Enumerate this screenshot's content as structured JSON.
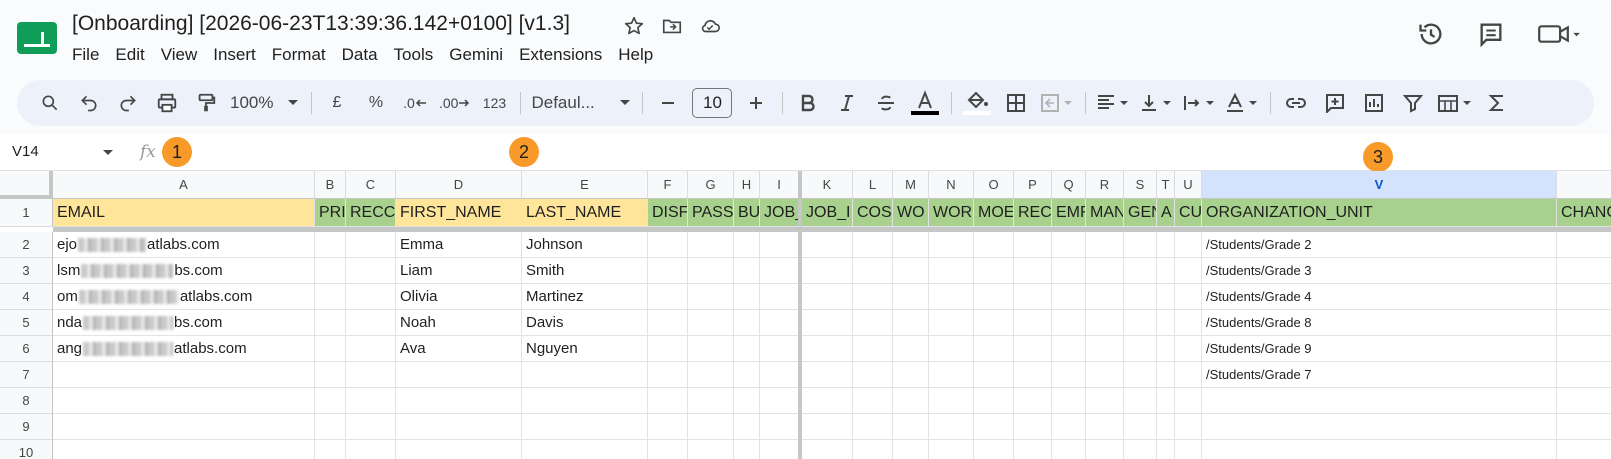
{
  "window": {
    "title": "[Onboarding] [2026-06-23T13:39:36.142+0100] [v1.3]"
  },
  "menu": [
    "File",
    "Edit",
    "View",
    "Insert",
    "Format",
    "Data",
    "Tools",
    "Gemini",
    "Extensions",
    "Help"
  ],
  "toolbar": {
    "zoom": "100%",
    "currency": "£",
    "percent": "%",
    "decrease_decimal": ".0",
    "increase_decimal": ".00",
    "number_format": "123",
    "font": "Defaul...",
    "font_size": "10"
  },
  "formula_bar": {
    "cell_ref": "V14",
    "fx": "fx",
    "content": ""
  },
  "markers": [
    "1",
    "2",
    "3"
  ],
  "columns": [
    "A",
    "B",
    "C",
    "D",
    "E",
    "F",
    "G",
    "H",
    "I",
    "K",
    "L",
    "M",
    "N",
    "O",
    "P",
    "Q",
    "R",
    "S",
    "T",
    "U",
    "V"
  ],
  "selected_column": "V",
  "row_numbers": [
    "1",
    "2",
    "3",
    "4",
    "5",
    "6",
    "7",
    "8",
    "9",
    "10"
  ],
  "header_row": {
    "A": "EMAIL",
    "B": "PRI",
    "C": "RECC",
    "D": "FIRST_NAME",
    "E": "LAST_NAME",
    "F": "DISF",
    "G": "PASS",
    "H": "BU",
    "I": "JOB_",
    "K": "JOB_I",
    "L": "COS",
    "M": "WO",
    "N": "WOR",
    "O": "MOE",
    "P": "REC",
    "Q": "EMF",
    "R": "MAN",
    "S": "GEN",
    "T": "A",
    "U": "CU",
    "V": "ORGANIZATION_UNIT",
    "W": "CHANG"
  },
  "rows": [
    {
      "email_start": "ejo",
      "email_end": "atlabs.com",
      "first": "Emma",
      "last": "Johnson",
      "ou": "/Students/Grade 2"
    },
    {
      "email_start": "lsm",
      "email_end": "bs.com",
      "first": "Liam",
      "last": "Smith",
      "ou": "/Students/Grade 3"
    },
    {
      "email_start": "om",
      "email_end": "atlabs.com",
      "first": "Olivia",
      "last": "Martinez",
      "ou": "/Students/Grade 4"
    },
    {
      "email_start": "nda",
      "email_end": "bs.com",
      "first": "Noah",
      "last": "Davis",
      "ou": "/Students/Grade 8"
    },
    {
      "email_start": "ang",
      "email_end": "atlabs.com",
      "first": "Ava",
      "last": "Nguyen",
      "ou": "/Students/Grade 9"
    },
    {
      "email_start": "",
      "email_end": "",
      "first": "",
      "last": "",
      "ou": "/Students/Grade 7"
    }
  ],
  "colors": {
    "header_yellow": "#ffe599",
    "header_green": "#a9d18e",
    "marker_orange": "#f79a2a",
    "selected_col": "#d3e3fd",
    "logo_green": "#0f9d58"
  }
}
